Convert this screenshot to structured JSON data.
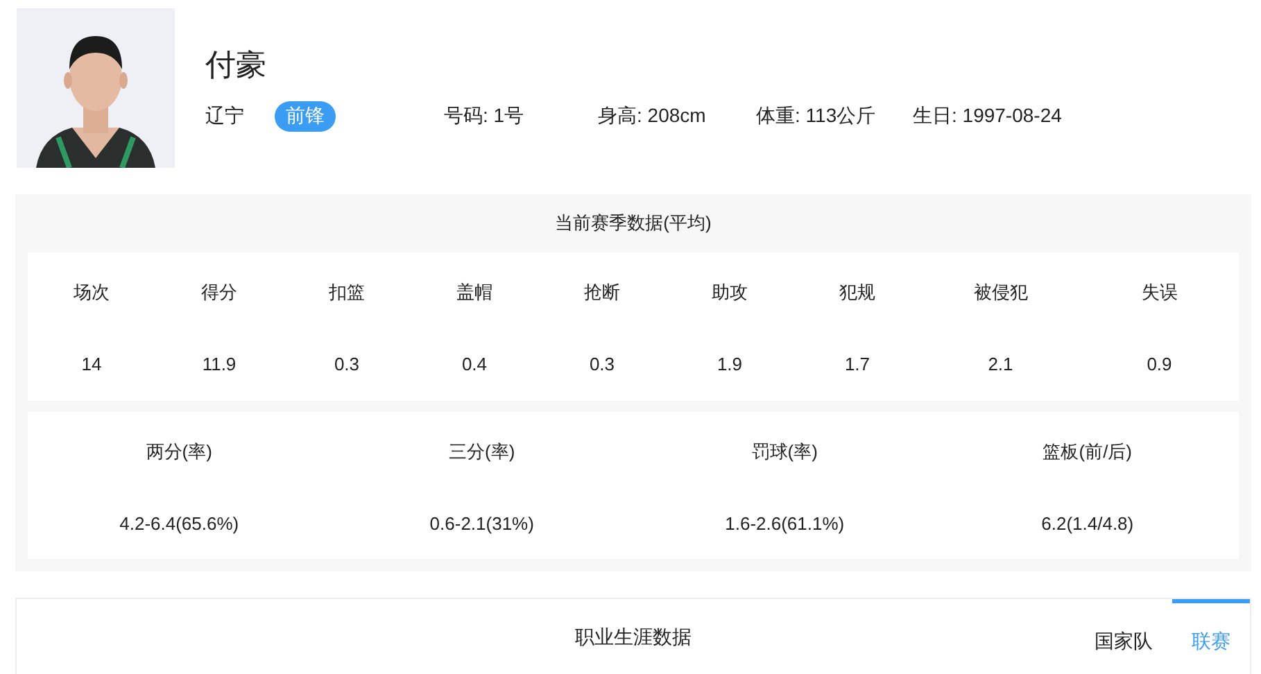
{
  "player": {
    "name": "付豪",
    "team": "辽宁",
    "position": "前锋",
    "info": [
      "号码: 1号",
      "身高: 208cm",
      "体重: 113公斤",
      "生日: 1997-08-24"
    ]
  },
  "season": {
    "title": "当前赛季数据(平均)",
    "basic": [
      {
        "label": "场次",
        "value": "14"
      },
      {
        "label": "得分",
        "value": "11.9"
      },
      {
        "label": "扣篮",
        "value": "0.3"
      },
      {
        "label": "盖帽",
        "value": "0.4"
      },
      {
        "label": "抢断",
        "value": "0.3"
      },
      {
        "label": "助攻",
        "value": "1.9"
      },
      {
        "label": "犯规",
        "value": "1.7"
      },
      {
        "label": "被侵犯",
        "value": "2.1"
      },
      {
        "label": "失误",
        "value": "0.9"
      }
    ],
    "shooting": [
      {
        "label": "两分(率)",
        "value": "4.2-6.4(65.6%)"
      },
      {
        "label": "三分(率)",
        "value": "0.6-2.1(31%)"
      },
      {
        "label": "罚球(率)",
        "value": "1.6-2.6(61.1%)"
      },
      {
        "label": "篮板(前/后)",
        "value": "6.2(1.4/4.8)"
      }
    ]
  },
  "career": {
    "title": "职业生涯数据",
    "tabs": [
      {
        "label": "国家队",
        "selected": false
      },
      {
        "label": "联赛",
        "selected": true
      }
    ]
  }
}
